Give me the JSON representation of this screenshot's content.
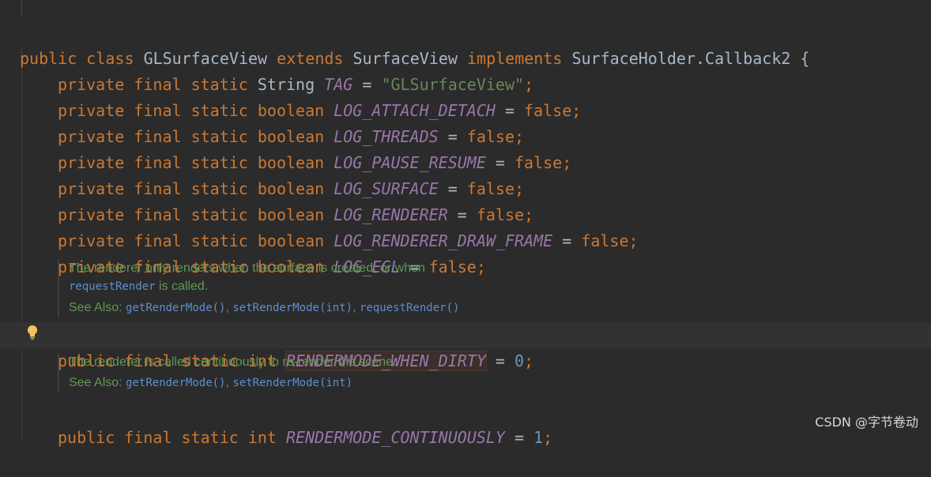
{
  "code": {
    "class_line": {
      "k1": "public",
      "k2": "class",
      "name": "GLSurfaceView",
      "k3": "extends",
      "parent": "SurfaceView",
      "k4": "implements",
      "iface": "SurfaceHolder.Callback2",
      "brace": "{"
    },
    "tag_line": {
      "mods": "private final static",
      "type": "String",
      "name": "TAG",
      "eq": "=",
      "value": "\"GLSurfaceView\"",
      "semi": ";"
    },
    "bool_fields": [
      {
        "name": "LOG_ATTACH_DETACH",
        "value": "false"
      },
      {
        "name": "LOG_THREADS",
        "value": "false"
      },
      {
        "name": "LOG_PAUSE_RESUME",
        "value": "false"
      },
      {
        "name": "LOG_SURFACE",
        "value": "false"
      },
      {
        "name": "LOG_RENDERER",
        "value": "false"
      },
      {
        "name": "LOG_RENDERER_DRAW_FRAME",
        "value": "false"
      },
      {
        "name": "LOG_EGL",
        "value": "false"
      }
    ],
    "bool_mods": "private final static",
    "bool_type": "boolean",
    "doc1": {
      "line1": "The renderer only renders when the surface is created, or when",
      "link": "requestRender",
      "line2_rest": " is called.",
      "see_also": "See Also: ",
      "refs": [
        "getRenderMode()",
        "setRenderMode(int)",
        "requestRender()"
      ],
      "sep": ", "
    },
    "dirty_line": {
      "mods": "public final static",
      "type": "int",
      "name": "RENDERMODE_WHEN_DIRTY",
      "eq": "=",
      "value": "0",
      "semi": ";"
    },
    "doc2": {
      "line1": "The renderer is called continuously to re-render the scene.",
      "see_also": "See Also: ",
      "refs": [
        "getRenderMode()",
        "setRenderMode(int)"
      ],
      "sep": ", "
    },
    "cont_line": {
      "mods": "public final static",
      "type": "int",
      "name": "RENDERMODE_CONTINUOUSLY",
      "eq": "=",
      "value": "1",
      "semi": ";"
    }
  },
  "watermark": "CSDN @字节卷动",
  "icons": {
    "intention": "lightbulb-icon"
  },
  "colors": {
    "background": "#2b2b2b",
    "keyword": "#cc7832",
    "field": "#9876aa",
    "string": "#6a8759",
    "number": "#6897bb",
    "doc": "#629755"
  }
}
